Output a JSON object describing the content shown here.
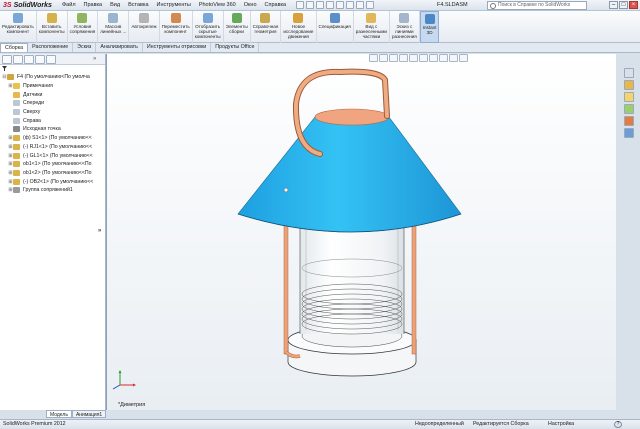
{
  "app": {
    "brand_prefix": "3S",
    "brand_name": "SolidWorks",
    "document_title": "F4.SLDASM",
    "search_placeholder": "Поиск в Справке по SolidWorks"
  },
  "menu": [
    "Файл",
    "Правка",
    "Вид",
    "Вставка",
    "Инструменты",
    "PhotoView 360",
    "Окно",
    "Справка"
  ],
  "toolbar": [
    {
      "label": "Редактировать\nкомпонент",
      "color": "#7aa6d8"
    },
    {
      "label": "Вставить\nкомпоненты",
      "color": "#d6b14a"
    },
    {
      "label": "Условия\nсопряжения",
      "color": "#8fb65e"
    },
    {
      "label": "Массив\nлинейных ...",
      "color": "#9bb4cf"
    },
    {
      "label": "Автокрепеж",
      "color": "#b4b4b4"
    },
    {
      "label": "Переместить\nкомпонент",
      "color": "#d08a52"
    },
    {
      "label": "Отобразить\nскрытые\nкомпоненты",
      "color": "#7aa6d8"
    },
    {
      "label": "Элементы\nсборки",
      "color": "#66a95a"
    },
    {
      "label": "Справочная\nгеометрия",
      "color": "#c9a94f"
    },
    {
      "label": "Новое\nисследование\nдвижения",
      "color": "#d9a13c"
    },
    {
      "label": "Спецификация",
      "color": "#5b8fc9"
    },
    {
      "label": "Вид с\nразнесенными\nчастями",
      "color": "#e0b85a"
    },
    {
      "label": "Эскиз с\nлиниями\nразнесения",
      "color": "#a3b6cc"
    },
    {
      "label": "Instant\n3D",
      "color": "#4c87c8"
    }
  ],
  "tabs": [
    "Сборка",
    "Расположение",
    "Эскиз",
    "Анализировать",
    "Инструменты отрисовки",
    "Продукты Office"
  ],
  "active_tab": "Сборка",
  "tree": {
    "filter_text": "",
    "items": [
      {
        "label": "F4  (По умолчанию<По умолча",
        "icon_color": "#d2a63f",
        "level": 0,
        "expander": "⊟"
      },
      {
        "label": "Примечания",
        "icon_color": "#e7c34d",
        "level": 1,
        "expander": "⊞"
      },
      {
        "label": "Датчики",
        "icon_color": "#e8b84e",
        "level": 1,
        "expander": ""
      },
      {
        "label": "Спереди",
        "icon_color": "#bcc7d3",
        "level": 1,
        "expander": ""
      },
      {
        "label": "Сверху",
        "icon_color": "#bcc7d3",
        "level": 1,
        "expander": ""
      },
      {
        "label": "Справа",
        "icon_color": "#bcc7d3",
        "level": 1,
        "expander": ""
      },
      {
        "label": "Исходная точка",
        "icon_color": "#888888",
        "level": 1,
        "expander": ""
      },
      {
        "label": "(ф) S1<1> (По умолчанию<<",
        "icon_color": "#d9b44a",
        "level": 1,
        "expander": "⊞"
      },
      {
        "label": "(-) RJ1<1> (По умолчанию<<",
        "icon_color": "#d9b44a",
        "level": 1,
        "expander": "⊞"
      },
      {
        "label": "(-) GL1<1> (По умолчанию<<",
        "icon_color": "#d9b44a",
        "level": 1,
        "expander": "⊞"
      },
      {
        "label": "ob1<1> (По умолчанию<<По",
        "icon_color": "#d9b44a",
        "level": 1,
        "expander": "⊞"
      },
      {
        "label": "ob1<2> (По умолчанию<<По",
        "icon_color": "#d9b44a",
        "level": 1,
        "expander": "⊞"
      },
      {
        "label": "(-) OB2<1> (По умолчанию<<",
        "icon_color": "#d9b44a",
        "level": 1,
        "expander": "⊞"
      },
      {
        "label": "Группа сопряжений1",
        "icon_color": "#9a9a9a",
        "level": 1,
        "expander": "⊞"
      }
    ]
  },
  "bottom_tabs": [
    "Модель",
    "Анимация1"
  ],
  "active_bottom_tab": "Модель",
  "view_label": "*Диметрия",
  "status": {
    "version": "SolidWorks Premium 2012",
    "definition": "Недоопределенный",
    "editing": "Редактируется Сборка",
    "units": "Настройка",
    "help": "?"
  },
  "model_colors": {
    "shade": "#29b3ec",
    "rim": "#1e8fc6",
    "handle": "#e9a47a",
    "glass": "#f2f5f7",
    "thread": "#666666"
  }
}
